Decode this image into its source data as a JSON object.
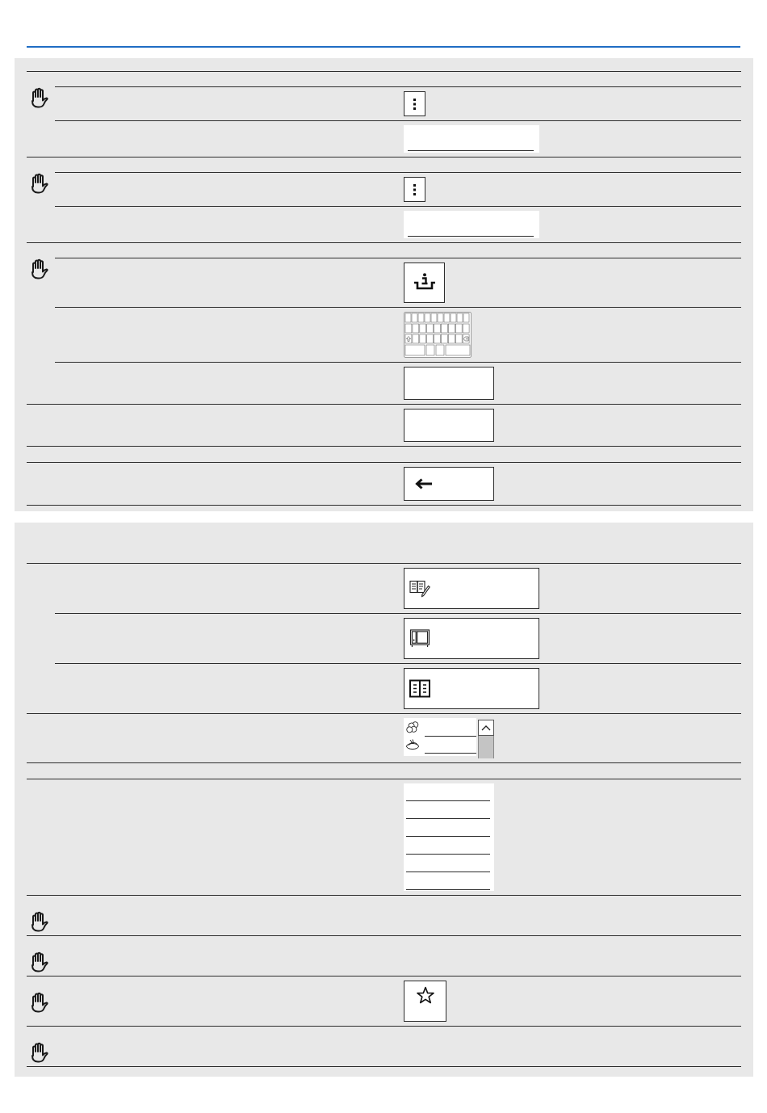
{
  "panels": [
    {
      "rows": [
        {
          "caution": true,
          "children": [
            {
              "kind": "empty"
            },
            {
              "kind": "menu"
            },
            {
              "kind": "field"
            }
          ]
        },
        {
          "caution": true,
          "children": [
            {
              "kind": "empty"
            },
            {
              "kind": "menu"
            },
            {
              "kind": "field"
            }
          ]
        },
        {
          "caution": true,
          "children": [
            {
              "kind": "empty"
            },
            {
              "kind": "info"
            },
            {
              "kind": "keyboard"
            },
            {
              "kind": "button"
            }
          ]
        },
        {
          "caution": false,
          "kind": "button"
        },
        {
          "caution": false,
          "kind": "empty"
        },
        {
          "caution": false,
          "kind": "back"
        }
      ]
    },
    {
      "rows": [
        {
          "caution": false,
          "children": [
            {
              "kind": "tile"
            },
            {
              "kind": "tile"
            },
            {
              "kind": "tile"
            }
          ]
        },
        {
          "caution": false,
          "kind": "picker"
        },
        {
          "caution": false,
          "kind": "empty"
        },
        {
          "caution": false,
          "kind": "lines"
        },
        {
          "caution": true,
          "kind": "empty"
        },
        {
          "caution": true,
          "kind": "empty"
        },
        {
          "caution": true,
          "kind": "star"
        },
        {
          "caution": true,
          "kind": "empty"
        }
      ]
    }
  ]
}
